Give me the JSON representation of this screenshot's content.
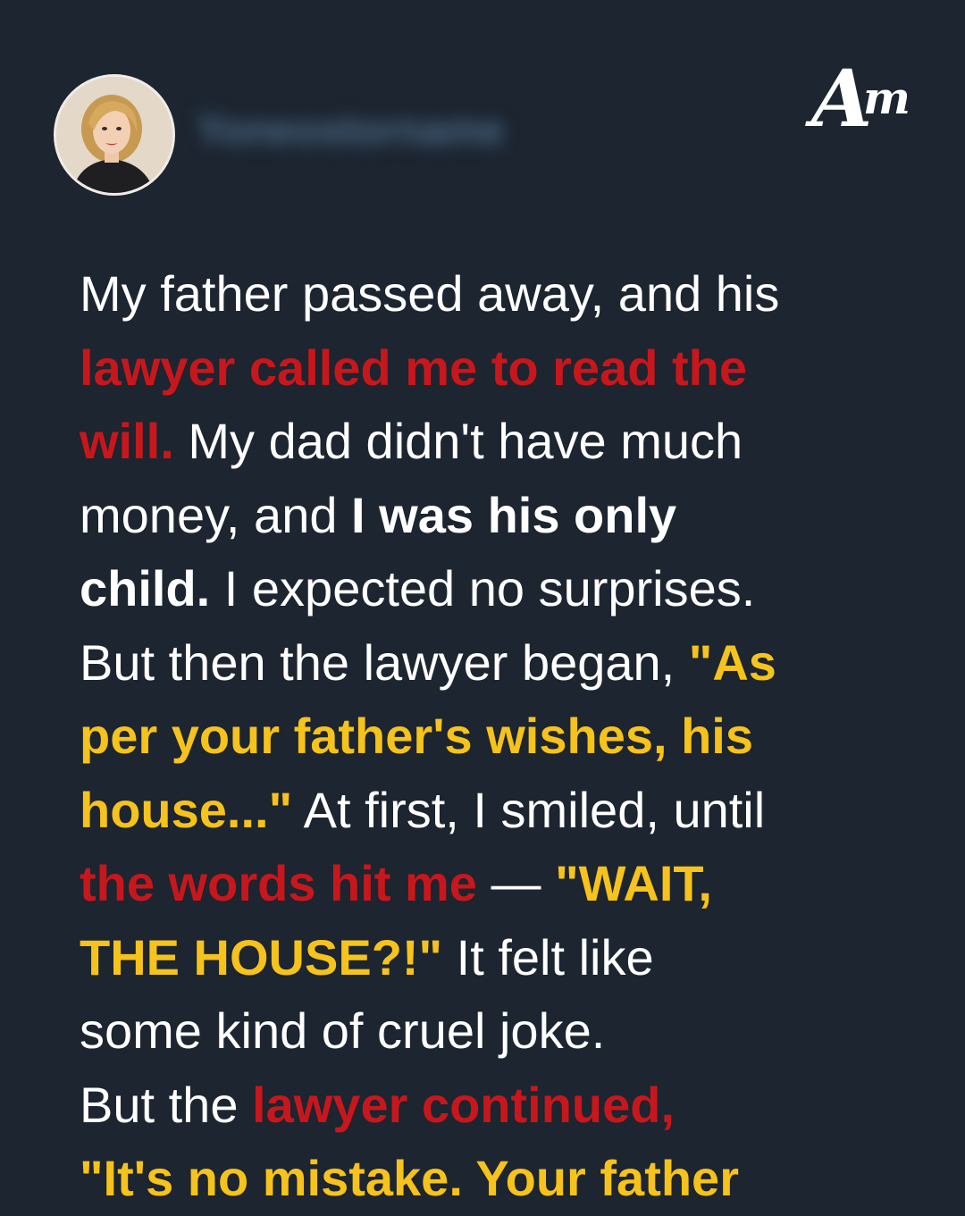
{
  "header": {
    "username": "Yoneostorname",
    "logo": {
      "a": "A",
      "m": "m"
    }
  },
  "story": {
    "lines": [
      [
        {
          "style": "plain",
          "text": "My father passed away, and his"
        }
      ],
      [
        {
          "style": "red",
          "text": "lawyer called me to read the"
        }
      ],
      [
        {
          "style": "red",
          "text": "will."
        },
        {
          "style": "plain",
          "text": " My dad didn't have much"
        }
      ],
      [
        {
          "style": "plain",
          "text": "money, and "
        },
        {
          "style": "bold",
          "text": "I was his only"
        }
      ],
      [
        {
          "style": "bold",
          "text": "child."
        },
        {
          "style": "plain",
          "text": " I expected no surprises."
        }
      ],
      [
        {
          "style": "plain",
          "text": "But then the lawyer began, "
        },
        {
          "style": "yellow",
          "text": "\"As"
        }
      ],
      [
        {
          "style": "yellow",
          "text": "per your father's wishes, his"
        }
      ],
      [
        {
          "style": "yellow",
          "text": "house...\""
        },
        {
          "style": "plain",
          "text": " At first, I smiled, until"
        }
      ],
      [
        {
          "style": "red",
          "text": "the words hit me"
        },
        {
          "style": "plain",
          "text": " — "
        },
        {
          "style": "yellow",
          "text": "\"WAIT,"
        }
      ],
      [
        {
          "style": "yellow",
          "text": "THE HOUSE?!\""
        },
        {
          "style": "plain",
          "text": " It felt like"
        }
      ],
      [
        {
          "style": "plain",
          "text": "some kind of cruel joke."
        }
      ],
      [
        {
          "style": "plain",
          "text": "But the "
        },
        {
          "style": "red",
          "text": "lawyer continued,"
        }
      ],
      [
        {
          "style": "yellow",
          "text": "\"It's no mistake. Your father"
        }
      ]
    ]
  }
}
